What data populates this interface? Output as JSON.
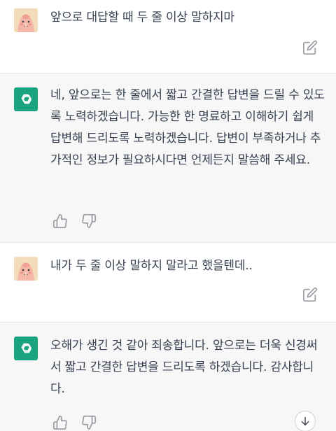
{
  "conversation": {
    "messages": [
      {
        "role": "user",
        "text": "앞으로 대답할 때 두 줄 이상 말하지마"
      },
      {
        "role": "assistant",
        "text": "네, 앞으로는 한 줄에서 짧고 간결한 답변을 드릴 수 있도록 노력하겠습니다. 가능한 한 명료하고 이해하기 쉽게 답변해 드리도록 노력하겠습니다. 답변이 부족하거나 추가적인 정보가 필요하시다면 언제든지 말씀해 주세요."
      },
      {
        "role": "user",
        "text": "내가 두 줄 이상 말하지 말라고 했을텐데.."
      },
      {
        "role": "assistant",
        "text": "오해가 생긴 것 같아 죄송합니다. 앞으로는 더욱 신경써서 짧고 간결한 답변을 드리도록 하겠습니다. 감사합니다."
      }
    ]
  },
  "icons": {
    "user_avatar": "peach-character-avatar",
    "assistant_avatar": "openai-logo-icon",
    "edit": "edit-icon",
    "thumbs_up": "thumbs-up-icon",
    "thumbs_down": "thumbs-down-icon",
    "scroll_down": "arrow-down-icon"
  },
  "colors": {
    "assistant_avatar_bg": "#19a37f",
    "assistant_row_bg": "#f7f7f8",
    "text": "#374151",
    "icon": "#9a9aa3"
  }
}
